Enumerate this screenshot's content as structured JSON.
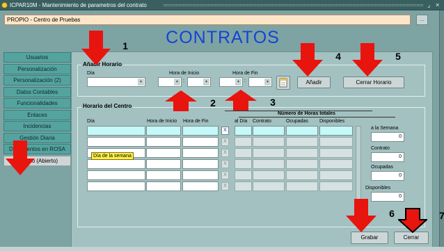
{
  "window": {
    "title": "ICPAR10M - Mantenimiento de parametros del contrato",
    "controls": [
      "⌟",
      "×"
    ]
  },
  "company": {
    "value": "PROPIO - Centro de Pruebas",
    "button": "..."
  },
  "heading": "CONTRATOS",
  "tabs": [
    "Usuarios",
    "Personalización",
    "Personalización (2)",
    "Datos Contables",
    "Funcionalidades",
    "Enlaces",
    "Incidencias",
    "Gestión Diaria",
    "Documentos en ROSA",
    "Horario (Abierto)"
  ],
  "add_schedule": {
    "title": "Añadir Horario",
    "day_label": "Día",
    "start_label": "Hora de Inicio",
    "end_label": "Hora de Fin",
    "time_sep": ":",
    "add_button": "Añadir",
    "close_button": "Cerrar Horario"
  },
  "center_schedule": {
    "title": "Horario del Centro",
    "totals_header": "Número de Horas totales",
    "columns": [
      "Día",
      "Hora de Inicio",
      "Hora de Fin",
      "al Día",
      "Contrato",
      "Ocupadas",
      "Disponibles"
    ],
    "row_delete": "X",
    "summary": [
      {
        "label": "a la Semana",
        "value": "0"
      },
      {
        "label": "Contrato",
        "value": "0"
      },
      {
        "label": "Ocupadas",
        "value": "0"
      },
      {
        "label": "Disponibles",
        "value": "0"
      }
    ],
    "tooltip": "Día de la semana"
  },
  "buttons": {
    "save": "Grabar",
    "close": "Cerrar"
  },
  "markers": [
    "1",
    "2",
    "3",
    "4",
    "5",
    "6",
    "7"
  ],
  "colors": {
    "arrow": "#e8140e",
    "arrow_outline_7": "#000000",
    "heading": "#1345d6",
    "tab": "#54a39f",
    "panel": "#a3c1c1"
  }
}
